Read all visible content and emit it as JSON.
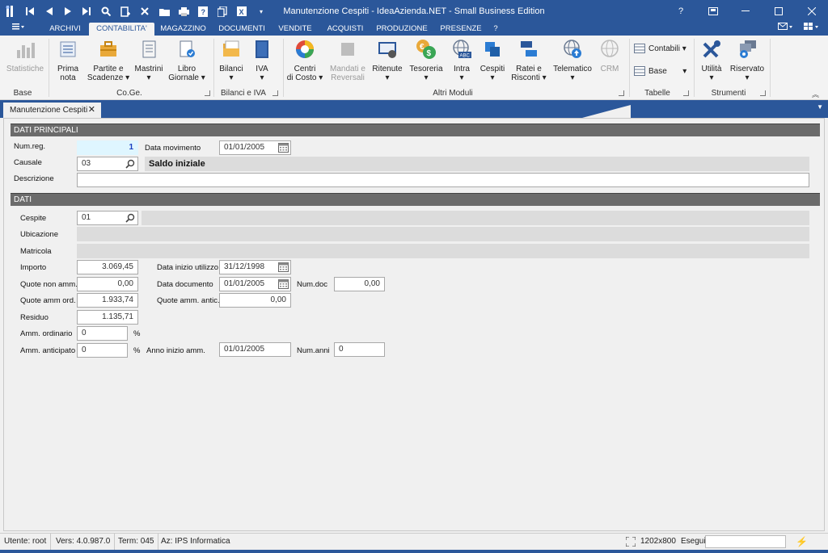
{
  "window": {
    "title": "Manutenzione Cespiti - IdeaAzienda.NET - Small Business Edition"
  },
  "menu": [
    "ARCHIVI",
    "CONTABILITA'",
    "MAGAZZINO",
    "DOCUMENTI",
    "VENDITE",
    "ACQUISTI",
    "PRODUZIONE",
    "PRESENZE",
    "?"
  ],
  "ribbon": {
    "buttons": {
      "statistiche": "Statistiche",
      "prima_nota_1": "Prima",
      "prima_nota_2": "nota",
      "partite_1": "Partite e",
      "partite_2": "Scadenze",
      "mastrini": "Mastrini",
      "libro_1": "Libro",
      "libro_2": "Giornale",
      "bilanci": "Bilanci",
      "iva": "IVA",
      "centri_1": "Centri",
      "centri_2": "di Costo",
      "mandati_1": "Mandati e",
      "mandati_2": "Reversali",
      "ritenute": "Ritenute",
      "tesoreria": "Tesoreria",
      "intra": "Intra",
      "cespiti": "Cespiti",
      "ratei_1": "Ratei e",
      "ratei_2": "Risconti",
      "telematico": "Telematico",
      "crm": "CRM",
      "contabili": "Contabili",
      "base": "Base",
      "utilita": "Utilità",
      "riservato": "Riservato"
    },
    "groups": [
      "Base",
      "Co.Ge.",
      "Bilanci e IVA",
      "Altri Moduli",
      "Tabelle",
      "Strumenti"
    ]
  },
  "doc_tab": {
    "label": "Manutenzione Cespiti"
  },
  "form": {
    "sections": [
      "DATI PRINCIPALI",
      "DATI"
    ],
    "num_reg": {
      "label": "Num.reg.",
      "value": "1"
    },
    "data_movimento": {
      "label": "Data movimento",
      "value": "01/01/2005"
    },
    "causale": {
      "label": "Causale",
      "value": "03",
      "desc": "Saldo iniziale"
    },
    "descrizione": {
      "label": "Descrizione",
      "value": ""
    },
    "cespite": {
      "label": "Cespite",
      "value": "01"
    },
    "ubicazione": {
      "label": "Ubicazione"
    },
    "matricola": {
      "label": "Matricola"
    },
    "importo": {
      "label": "Importo",
      "value": "3.069,45"
    },
    "data_inizio_utilizzo": {
      "label": "Data inizio utilizzo",
      "value": "31/12/1998"
    },
    "quote_non_amm": {
      "label": "Quote non amm.",
      "value": "0,00"
    },
    "data_documento": {
      "label": "Data documento",
      "value": "01/01/2005"
    },
    "num_doc": {
      "label": "Num.doc",
      "value": "0,00"
    },
    "quote_amm_ord": {
      "label": "Quote amm ord.",
      "value": "1.933,74"
    },
    "quote_amm_antic": {
      "label": "Quote amm. antic.",
      "value": "0,00"
    },
    "residuo": {
      "label": "Residuo",
      "value": "1.135,71"
    },
    "amm_ordinario": {
      "label": "Amm. ordinario",
      "value": "0",
      "unit": "%"
    },
    "amm_anticipato": {
      "label": "Amm. anticipato",
      "value": "0",
      "unit": "%"
    },
    "anno_inizio_amm": {
      "label": "Anno inizio amm.",
      "value": "01/01/2005"
    },
    "num_anni": {
      "label": "Num.anni",
      "value": "0"
    }
  },
  "statusbar": {
    "utente": "Utente: root",
    "vers": "Vers: 4.0.987.0",
    "term": "Term: 045",
    "az": "Az: IPS Informatica",
    "resolution": "1202x800",
    "esegui": "Esegui"
  },
  "colors": {
    "accent": "#2b579a",
    "section": "#6b6b6b",
    "readonly": "#dcdcdc"
  }
}
